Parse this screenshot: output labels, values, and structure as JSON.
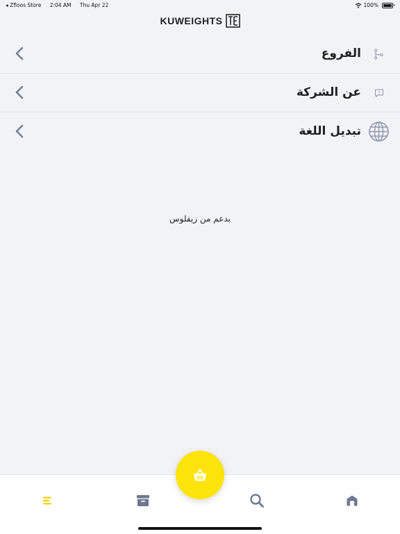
{
  "status_bar": {
    "back_app": "◂ Zfloos Store",
    "time": "2:04 AM",
    "date": "Thu Apr 22",
    "battery": "100%"
  },
  "header": {
    "brand": "KUWEIGHTS"
  },
  "menu": {
    "items": [
      {
        "label": "الفروع",
        "icon": "branch-icon"
      },
      {
        "label": "عن الشركة",
        "icon": "info-message-icon"
      },
      {
        "label": "تبديل اللغة",
        "icon": "globe-icon"
      }
    ]
  },
  "footer": {
    "powered_by": "بدعم من زيفلوس"
  },
  "tab_bar": {
    "tabs": [
      {
        "icon": "menu-icon",
        "active": true
      },
      {
        "icon": "archive-icon",
        "active": false
      },
      {
        "icon": "basket-icon",
        "active": false
      },
      {
        "icon": "search-icon",
        "active": false
      },
      {
        "icon": "store-icon",
        "active": false
      }
    ]
  },
  "colors": {
    "background": "#f1f3f7",
    "accent": "#fce30a",
    "active_tab": "#f3d40d",
    "inactive_icon": "#6e7891"
  }
}
